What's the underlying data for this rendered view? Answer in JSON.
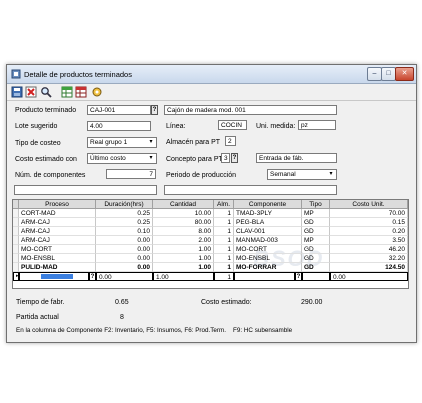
{
  "window": {
    "title": "Detalle de productos terminados"
  },
  "toolbar": {
    "icons": [
      "save-icon",
      "delete-icon",
      "search-icon",
      "table-green-icon",
      "table-red-icon",
      "tools-icon"
    ]
  },
  "form": {
    "producto_label": "Producto terminado",
    "producto_code": "CAJ-001",
    "producto_desc": "Cajón de madera mod. 001",
    "lote_label": "Lote sugerido",
    "lote_value": "4.00",
    "linea_label": "Línea:",
    "linea_value": "COCIN",
    "unidad_label": "Uni. medida:",
    "unidad_value": "pz",
    "tipo_costeo_label": "Tipo de costeo",
    "tipo_costeo_value": "Real grupo 1",
    "almacen_label": "Almacén para PT",
    "almacen_value": "2",
    "costo_est_label": "Costo estimado con",
    "costo_est_value": "Último costo",
    "concepto_label": "Concepto para PT",
    "concepto_value": "3",
    "concepto_desc": "Entrada de fáb.",
    "num_comp_label": "Núm. de componentes",
    "num_comp_value": "7",
    "periodo_label": "Periodo de producción",
    "periodo_value": "Semanal"
  },
  "grid": {
    "headers": [
      "Proceso",
      "Duración(hrs)",
      "Cantidad",
      "Alm.",
      "Componente",
      "Tipo",
      "Costo Unit."
    ],
    "rows": [
      {
        "proceso": "CORT-MAD",
        "duracion": "0.25",
        "cantidad": "10.00",
        "alm": "1",
        "componente": "TMAD-3PLY",
        "tipo": "MP",
        "costo": "70.00"
      },
      {
        "proceso": "ARM-CAJ",
        "duracion": "0.25",
        "cantidad": "80.00",
        "alm": "1",
        "componente": "PEG-BLA",
        "tipo": "GD",
        "costo": "0.15"
      },
      {
        "proceso": "ARM-CAJ",
        "duracion": "0.10",
        "cantidad": "8.00",
        "alm": "1",
        "componente": "CLAV-001",
        "tipo": "GD",
        "costo": "0.20"
      },
      {
        "proceso": "ARM-CAJ",
        "duracion": "0.00",
        "cantidad": "2.00",
        "alm": "1",
        "componente": "MANMAD-003",
        "tipo": "MP",
        "costo": "3.50"
      },
      {
        "proceso": "MO-CORT",
        "duracion": "0.00",
        "cantidad": "1.00",
        "alm": "1",
        "componente": "MO-CORT",
        "tipo": "GD",
        "costo": "46.20"
      },
      {
        "proceso": "MO-ENSBL",
        "duracion": "0.00",
        "cantidad": "1.00",
        "alm": "1",
        "componente": "MO-ENSBL",
        "tipo": "GD",
        "costo": "32.20"
      },
      {
        "proceso": "PULID-MAD",
        "duracion": "0.00",
        "cantidad": "1.00",
        "alm": "1",
        "componente": "MO-FORRAR",
        "tipo": "GD",
        "costo": "124.50"
      }
    ],
    "edit_row": {
      "duracion": "0.00",
      "cantidad": "1.00",
      "alm": "1",
      "costo": "0.00"
    },
    "watermark": "BSOD"
  },
  "footer": {
    "tiempo_label": "Tiempo de fabr.",
    "tiempo_value": "0.65",
    "costo_label": "Costo estimado:",
    "costo_value": "290.00",
    "partida_label": "Partida actual",
    "partida_value": "8",
    "hint": "En la columna de Componente F2: Inventario, F5: Insumos, F6: Prod.Term.",
    "hint2": "F9: HC subensamble"
  }
}
